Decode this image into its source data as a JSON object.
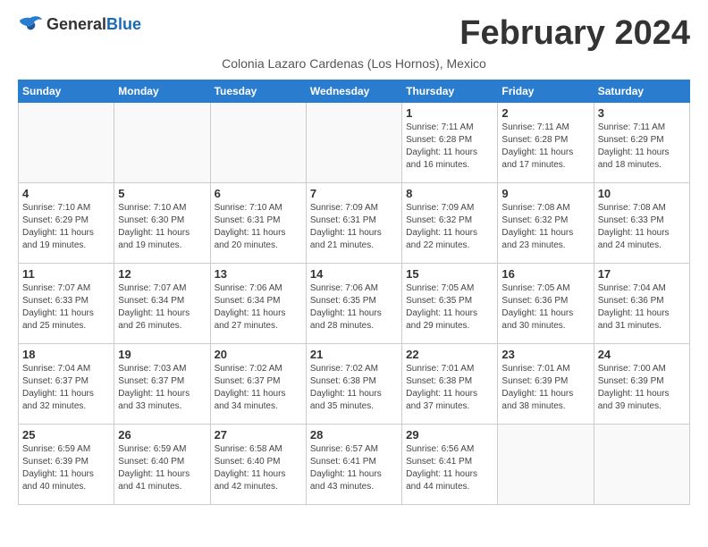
{
  "header": {
    "logo_general": "General",
    "logo_blue": "Blue",
    "month_title": "February 2024",
    "subtitle": "Colonia Lazaro Cardenas (Los Hornos), Mexico"
  },
  "weekdays": [
    "Sunday",
    "Monday",
    "Tuesday",
    "Wednesday",
    "Thursday",
    "Friday",
    "Saturday"
  ],
  "weeks": [
    [
      {
        "day": "",
        "info": ""
      },
      {
        "day": "",
        "info": ""
      },
      {
        "day": "",
        "info": ""
      },
      {
        "day": "",
        "info": ""
      },
      {
        "day": "1",
        "info": "Sunrise: 7:11 AM\nSunset: 6:28 PM\nDaylight: 11 hours\nand 16 minutes."
      },
      {
        "day": "2",
        "info": "Sunrise: 7:11 AM\nSunset: 6:28 PM\nDaylight: 11 hours\nand 17 minutes."
      },
      {
        "day": "3",
        "info": "Sunrise: 7:11 AM\nSunset: 6:29 PM\nDaylight: 11 hours\nand 18 minutes."
      }
    ],
    [
      {
        "day": "4",
        "info": "Sunrise: 7:10 AM\nSunset: 6:29 PM\nDaylight: 11 hours\nand 19 minutes."
      },
      {
        "day": "5",
        "info": "Sunrise: 7:10 AM\nSunset: 6:30 PM\nDaylight: 11 hours\nand 19 minutes."
      },
      {
        "day": "6",
        "info": "Sunrise: 7:10 AM\nSunset: 6:31 PM\nDaylight: 11 hours\nand 20 minutes."
      },
      {
        "day": "7",
        "info": "Sunrise: 7:09 AM\nSunset: 6:31 PM\nDaylight: 11 hours\nand 21 minutes."
      },
      {
        "day": "8",
        "info": "Sunrise: 7:09 AM\nSunset: 6:32 PM\nDaylight: 11 hours\nand 22 minutes."
      },
      {
        "day": "9",
        "info": "Sunrise: 7:08 AM\nSunset: 6:32 PM\nDaylight: 11 hours\nand 23 minutes."
      },
      {
        "day": "10",
        "info": "Sunrise: 7:08 AM\nSunset: 6:33 PM\nDaylight: 11 hours\nand 24 minutes."
      }
    ],
    [
      {
        "day": "11",
        "info": "Sunrise: 7:07 AM\nSunset: 6:33 PM\nDaylight: 11 hours\nand 25 minutes."
      },
      {
        "day": "12",
        "info": "Sunrise: 7:07 AM\nSunset: 6:34 PM\nDaylight: 11 hours\nand 26 minutes."
      },
      {
        "day": "13",
        "info": "Sunrise: 7:06 AM\nSunset: 6:34 PM\nDaylight: 11 hours\nand 27 minutes."
      },
      {
        "day": "14",
        "info": "Sunrise: 7:06 AM\nSunset: 6:35 PM\nDaylight: 11 hours\nand 28 minutes."
      },
      {
        "day": "15",
        "info": "Sunrise: 7:05 AM\nSunset: 6:35 PM\nDaylight: 11 hours\nand 29 minutes."
      },
      {
        "day": "16",
        "info": "Sunrise: 7:05 AM\nSunset: 6:36 PM\nDaylight: 11 hours\nand 30 minutes."
      },
      {
        "day": "17",
        "info": "Sunrise: 7:04 AM\nSunset: 6:36 PM\nDaylight: 11 hours\nand 31 minutes."
      }
    ],
    [
      {
        "day": "18",
        "info": "Sunrise: 7:04 AM\nSunset: 6:37 PM\nDaylight: 11 hours\nand 32 minutes."
      },
      {
        "day": "19",
        "info": "Sunrise: 7:03 AM\nSunset: 6:37 PM\nDaylight: 11 hours\nand 33 minutes."
      },
      {
        "day": "20",
        "info": "Sunrise: 7:02 AM\nSunset: 6:37 PM\nDaylight: 11 hours\nand 34 minutes."
      },
      {
        "day": "21",
        "info": "Sunrise: 7:02 AM\nSunset: 6:38 PM\nDaylight: 11 hours\nand 35 minutes."
      },
      {
        "day": "22",
        "info": "Sunrise: 7:01 AM\nSunset: 6:38 PM\nDaylight: 11 hours\nand 37 minutes."
      },
      {
        "day": "23",
        "info": "Sunrise: 7:01 AM\nSunset: 6:39 PM\nDaylight: 11 hours\nand 38 minutes."
      },
      {
        "day": "24",
        "info": "Sunrise: 7:00 AM\nSunset: 6:39 PM\nDaylight: 11 hours\nand 39 minutes."
      }
    ],
    [
      {
        "day": "25",
        "info": "Sunrise: 6:59 AM\nSunset: 6:39 PM\nDaylight: 11 hours\nand 40 minutes."
      },
      {
        "day": "26",
        "info": "Sunrise: 6:59 AM\nSunset: 6:40 PM\nDaylight: 11 hours\nand 41 minutes."
      },
      {
        "day": "27",
        "info": "Sunrise: 6:58 AM\nSunset: 6:40 PM\nDaylight: 11 hours\nand 42 minutes."
      },
      {
        "day": "28",
        "info": "Sunrise: 6:57 AM\nSunset: 6:41 PM\nDaylight: 11 hours\nand 43 minutes."
      },
      {
        "day": "29",
        "info": "Sunrise: 6:56 AM\nSunset: 6:41 PM\nDaylight: 11 hours\nand 44 minutes."
      },
      {
        "day": "",
        "info": ""
      },
      {
        "day": "",
        "info": ""
      }
    ]
  ]
}
